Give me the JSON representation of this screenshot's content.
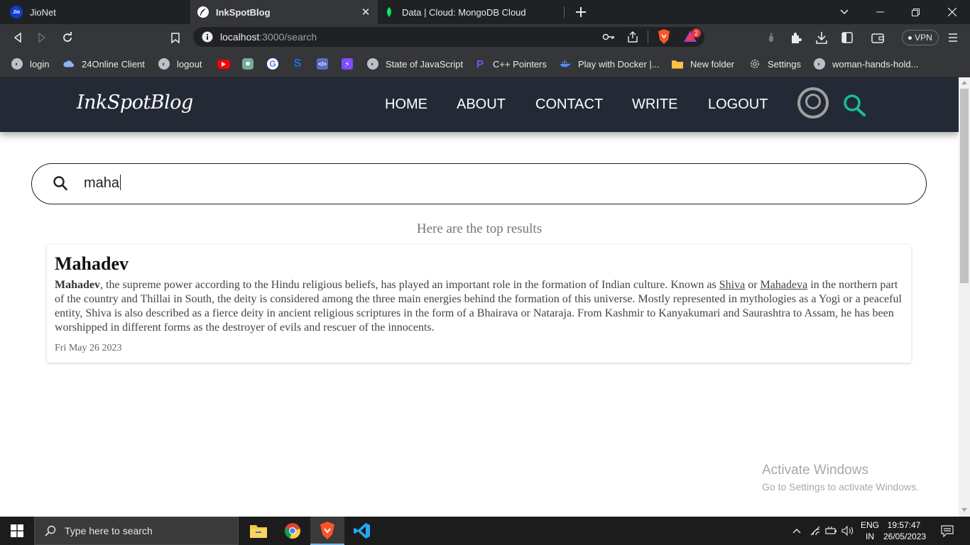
{
  "browser": {
    "tabs": [
      {
        "title": "JioNet",
        "favicon": "Jio"
      },
      {
        "title": "InkSpotBlog",
        "favicon": "feather"
      },
      {
        "title": "Data | Cloud: MongoDB Cloud",
        "favicon": "leaf"
      }
    ],
    "url_host": "localhost",
    "url_rest": ":3000/search",
    "vpn_label": "VPN",
    "brave_badge": "2",
    "bookmarks": [
      {
        "label": "login",
        "icon": "globe-icon",
        "color": "#9aa0a6"
      },
      {
        "label": "24Online Client",
        "icon": "cloud-icon",
        "color": "#8ab4f8"
      },
      {
        "label": "logout",
        "icon": "globe-icon",
        "color": "#9aa0a6"
      },
      {
        "label": "",
        "icon": "youtube-icon",
        "color": "#ff0000"
      },
      {
        "label": "",
        "icon": "chatgpt-icon",
        "color": "#74aa9c"
      },
      {
        "label": "",
        "icon": "google-icon",
        "color": "#ffffff"
      },
      {
        "label": "",
        "icon": "s-icon",
        "color": "#1a73e8"
      },
      {
        "label": "",
        "icon": "code-icon",
        "color": "#5c6bc0"
      },
      {
        "label": "",
        "icon": "bolt-icon",
        "color": "#7c4dff"
      },
      {
        "label": "State of JavaScript",
        "icon": "globe-icon",
        "color": "#9aa0a6"
      },
      {
        "label": "C++ Pointers",
        "icon": "p-icon",
        "color": "#7c4dff"
      },
      {
        "label": "Play with Docker |...",
        "icon": "docker-icon",
        "color": "#4f8ff7"
      },
      {
        "label": "New folder",
        "icon": "folder-icon",
        "color": "#f6c344"
      },
      {
        "label": "Settings",
        "icon": "gear-icon",
        "color": "#9aa0a6"
      },
      {
        "label": "woman-hands-hold...",
        "icon": "globe-icon",
        "color": "#9aa0a6"
      }
    ]
  },
  "site": {
    "logo": "InkSpotBlog",
    "nav": [
      "HOME",
      "ABOUT",
      "CONTACT",
      "WRITE",
      "LOGOUT"
    ],
    "accent": "#1abc9c"
  },
  "search": {
    "query": "maha"
  },
  "results": {
    "heading": "Here are the top results",
    "items": [
      {
        "title": "Mahadev",
        "body_bold": "Mahadev",
        "body_1": ", the supreme power according to the Hindu religious beliefs, has played an important role in the formation of Indian culture. Known as ",
        "link_1": "Shiva",
        "body_2": " or ",
        "link_2": "Mahadeva",
        "body_3": " in the northern part of the country and Thillai in South, the deity is considered among the three main energies behind the formation of this universe. Mostly represented in mythologies as a Yogi or a peaceful entity, Shiva is also described as a fierce deity in ancient religious scriptures in the form of a Bhairava or Nataraja. From Kashmir to Kanyakumari and Saurashtra to Assam, he has been worshipped in different forms as the destroyer of evils and rescuer of the innocents.",
        "date": "Fri May 26 2023"
      }
    ]
  },
  "watermark": {
    "line1": "Activate Windows",
    "line2": "Go to Settings to activate Windows."
  },
  "taskbar": {
    "search_placeholder": "Type here to search",
    "lang_1": "ENG",
    "lang_2": "IN",
    "time": "19:57:47",
    "date": "26/05/2023"
  }
}
